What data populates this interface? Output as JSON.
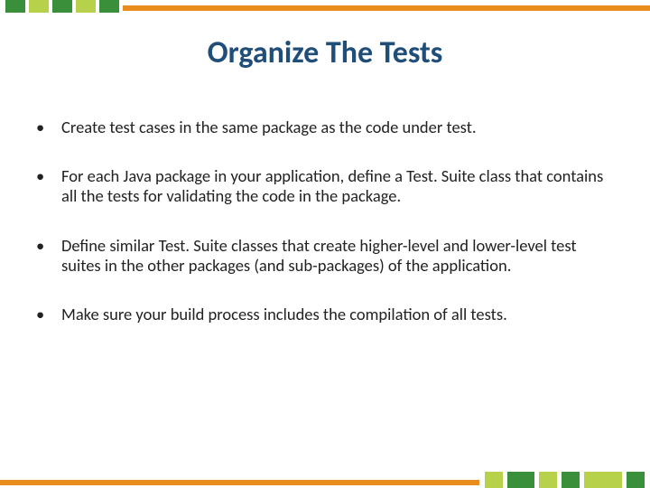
{
  "title": "Organize The Tests",
  "bullets": [
    "Create test cases in the same package as the code under test.",
    "For each Java package in your application, define a Test. Suite class that contains all the tests for validating the code in the package.",
    "Define similar Test. Suite classes that create higher-level and lower-level test suites in the other packages (and sub-packages) of the application.",
    "Make sure your build process includes the compilation of all tests."
  ],
  "colors": {
    "topSquares": [
      "#3a8f3a",
      "#b7d24a",
      "#3a8f3a",
      "#b7d24a",
      "#3a8f3a"
    ],
    "orange": "#e88c1e",
    "titleColor": "#1f4e79"
  }
}
